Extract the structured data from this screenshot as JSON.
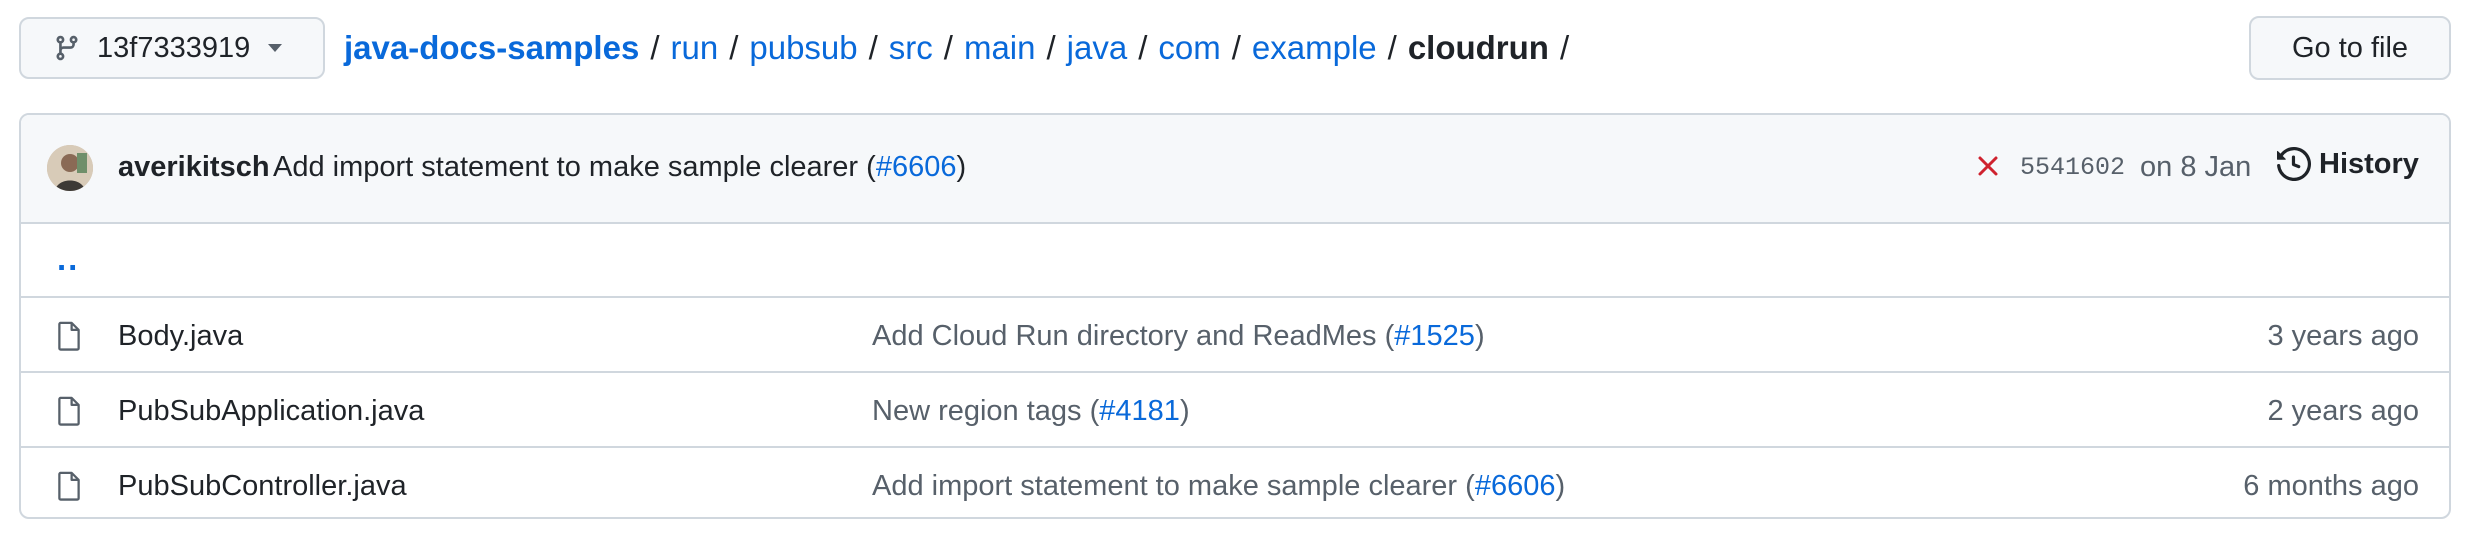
{
  "branch": {
    "name": "13f7333919",
    "icon": "git-branch-icon"
  },
  "breadcrumb": {
    "repo": "java-docs-samples",
    "separator": "/",
    "parts": [
      "run",
      "pubsub",
      "src",
      "main",
      "java",
      "com",
      "example"
    ],
    "current": "cloudrun",
    "trailing": "/"
  },
  "goto_file": {
    "label": "Go to file"
  },
  "latest_commit": {
    "author": "averikitsch",
    "message": "Add import statement to make sample clearer (",
    "pr": "#6606",
    "message_end": ")",
    "status_icon": "x-icon",
    "status_color": "#cf222e",
    "sha": "5541602",
    "date": "on 8 Jan",
    "history_label": "History"
  },
  "parent_dir": {
    "label": ".."
  },
  "files": [
    {
      "name": "Body.java",
      "msg": "Add Cloud Run directory and ReadMes (",
      "pr": "#1525",
      "msg_end": ")",
      "age": "3 years ago"
    },
    {
      "name": "PubSubApplication.java",
      "msg": "New region tags (",
      "pr": "#4181",
      "msg_end": ")",
      "age": "2 years ago"
    },
    {
      "name": "PubSubController.java",
      "msg": "Add import statement to make sample clearer (",
      "pr": "#6606",
      "msg_end": ")",
      "age": "6 months ago"
    }
  ],
  "colors": {
    "link": "#0969da",
    "text": "#1f2328",
    "muted": "#57606a",
    "border": "#d0d7de",
    "header_bg": "#f6f8fa"
  }
}
